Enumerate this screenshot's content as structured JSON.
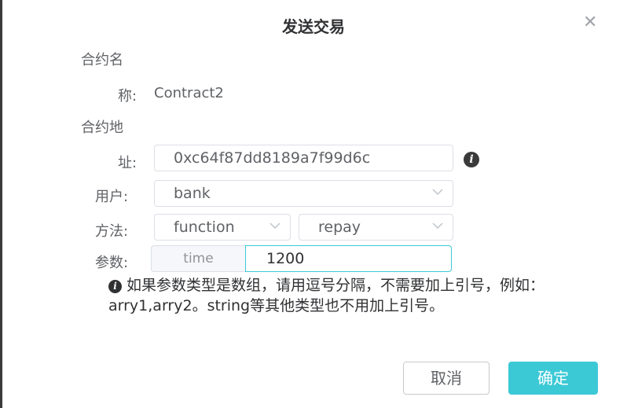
{
  "dialog": {
    "title": "发送交易",
    "close_icon": "close-icon"
  },
  "form": {
    "contract_name_label_line1": "合约名",
    "contract_name_label_line2": "称:",
    "contract_name_value": "Contract2",
    "contract_address_label_line1": "合约地",
    "contract_address_label_line2": "址:",
    "contract_address_value": "0xc64f87dd8189a7f99d6c",
    "user_label": "用户:",
    "user_value": "bank",
    "method_label": "方法:",
    "method_type_value": "function",
    "method_name_value": "repay",
    "params_label": "参数:",
    "param_name": "time",
    "param_value": "1200",
    "info_icon": "info-icon"
  },
  "tip": {
    "text": "如果参数类型是数组，请用逗号分隔，不需要加上引号，例如：arry1,arry2。string等其他类型也不用加上引号。"
  },
  "buttons": {
    "cancel": "取消",
    "confirm": "确定"
  },
  "colors": {
    "accent": "#3cc9d6",
    "border": "#dcdfe6",
    "text": "#606266"
  }
}
